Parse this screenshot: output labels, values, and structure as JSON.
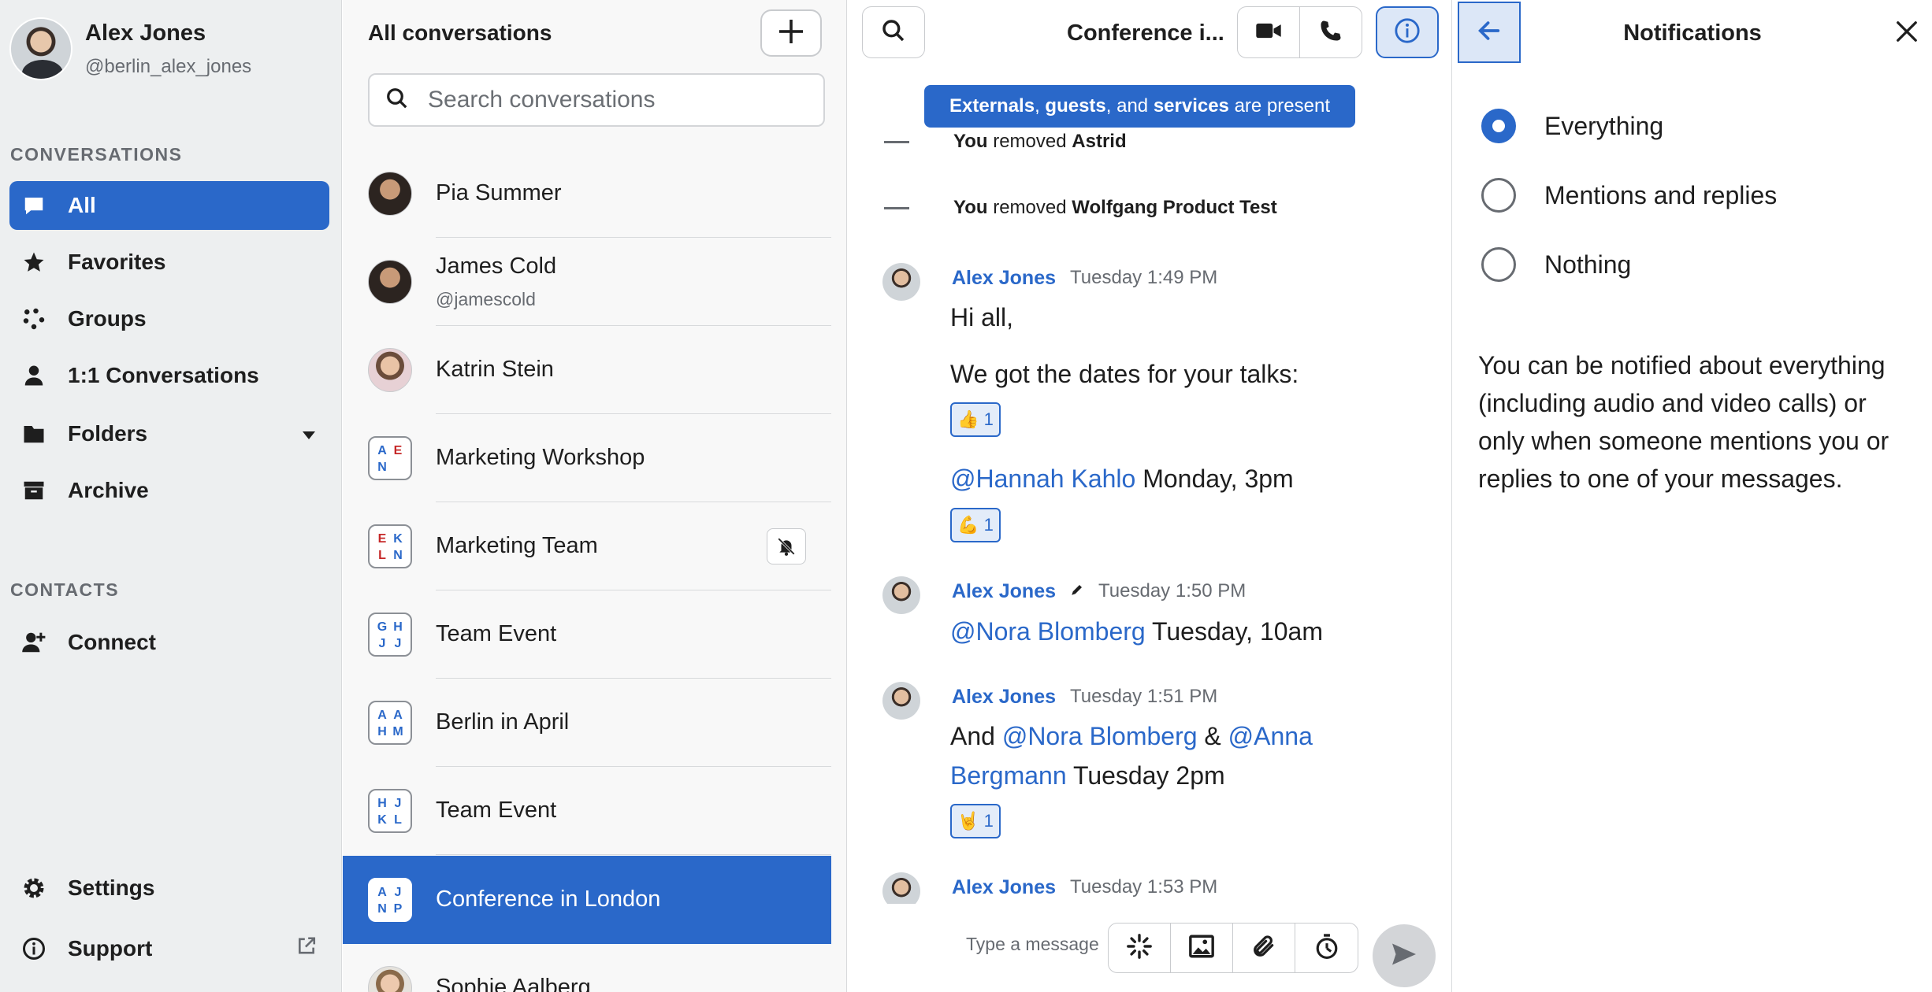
{
  "user": {
    "name": "Alex Jones",
    "handle": "@berlin_alex_jones"
  },
  "sidebar": {
    "conversations_label": "CONVERSATIONS",
    "items": [
      {
        "label": "All",
        "icon": "chat-bubble-icon"
      },
      {
        "label": "Favorites",
        "icon": "star-icon"
      },
      {
        "label": "Groups",
        "icon": "groups-icon"
      },
      {
        "label": "1:1 Conversations",
        "icon": "person-icon"
      },
      {
        "label": "Folders",
        "icon": "folder-icon"
      },
      {
        "label": "Archive",
        "icon": "archive-icon"
      }
    ],
    "contacts_label": "CONTACTS",
    "connect_label": "Connect",
    "settings_label": "Settings",
    "support_label": "Support"
  },
  "convlist": {
    "title": "All conversations",
    "search_placeholder": "Search conversations",
    "items": [
      {
        "name": "Pia Summer",
        "type": "person"
      },
      {
        "name": "James Cold",
        "sub": "@jamescold",
        "type": "person"
      },
      {
        "name": "Katrin Stein",
        "type": "person"
      },
      {
        "name": "Marketing Workshop",
        "type": "group",
        "initials": [
          "A",
          "E",
          "N",
          ""
        ]
      },
      {
        "name": "Marketing Team",
        "type": "group",
        "initials": [
          "E",
          "K",
          "L",
          "N"
        ],
        "muted": true
      },
      {
        "name": "Team Event",
        "type": "group",
        "initials": [
          "G",
          "H",
          "J",
          "J"
        ]
      },
      {
        "name": "Berlin in April",
        "type": "group",
        "initials": [
          "A",
          "A",
          "H",
          "M"
        ]
      },
      {
        "name": "Team Event",
        "type": "group",
        "initials": [
          "H",
          "J",
          "K",
          "L"
        ]
      },
      {
        "name": "Conference in London",
        "type": "group",
        "initials": [
          "A",
          "J",
          "N",
          "P"
        ],
        "active": true
      },
      {
        "name": "Sophie Aalberg",
        "type": "person"
      }
    ]
  },
  "chat": {
    "title": "Conference i...",
    "banner": {
      "w1": "Externals",
      "s1": ", ",
      "w2": "guests",
      "s2": ", and ",
      "w3": "services",
      "s3": " are present"
    },
    "system": [
      {
        "actor": "You",
        "verb": " removed ",
        "target": "Astrid"
      },
      {
        "actor": "You",
        "verb": " removed ",
        "target": "Wolfgang Product Test"
      }
    ],
    "messages": [
      {
        "author": "Alex Jones",
        "time": "Tuesday 1:49 PM",
        "line1": "Hi all,",
        "line2": "We got the dates for your talks:",
        "react1": "1",
        "mention1": "@Hannah Kahlo",
        "after1": " Monday, 3pm",
        "react2": "1"
      },
      {
        "author": "Alex Jones",
        "time": "Tuesday 1:50 PM",
        "mention": "@Nora Blomberg",
        "after": " Tuesday, 10am"
      },
      {
        "author": "Alex Jones",
        "time": "Tuesday 1:51 PM",
        "pre": "And ",
        "mention_a": "@Nora Blomberg",
        "amp": " & ",
        "mention_b": "@Anna Bergmann",
        "after": " Tuesday 2pm",
        "react": "1"
      },
      {
        "author": "Alex Jones",
        "time": "Tuesday 1:53 PM"
      }
    ],
    "composer_placeholder": "Type a message"
  },
  "panel": {
    "title": "Notifications",
    "options": [
      "Everything",
      "Mentions and replies",
      "Nothing"
    ],
    "selected": 0,
    "description": "You can be notified about everything (including audio and video calls) or only when someone mentions you or replies to one of your messages."
  },
  "colors": {
    "accent": "#2a68c9",
    "sidebar_bg": "#edeff0",
    "list_bg": "#f8f8f8"
  }
}
